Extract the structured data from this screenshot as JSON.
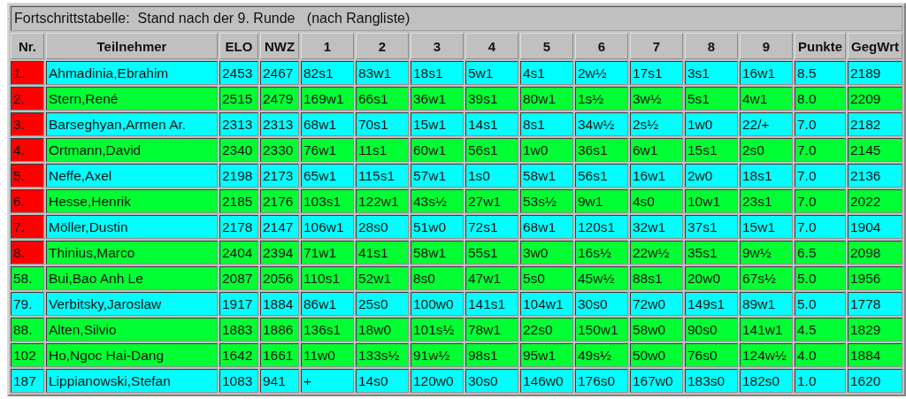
{
  "title": "Fortschrittstabelle:  Stand nach der 9. Runde   (nach Rangliste)",
  "columns": [
    "Nr.",
    "Teilnehmer",
    "ELO",
    "NWZ",
    "1",
    "2",
    "3",
    "4",
    "5",
    "6",
    "7",
    "8",
    "9",
    "Punkte",
    "GegWrt"
  ],
  "rows": [
    {
      "nr": "1.",
      "marked": true,
      "color": "#00ffff",
      "cells": [
        "Ahmadinia,Ebrahim",
        "2453",
        "2467",
        "82s1",
        "83w1",
        "18s1",
        "5w1",
        "4s1",
        "2w½",
        "17s1",
        "3s1",
        "16w1",
        "8.5",
        "2189"
      ]
    },
    {
      "nr": "2.",
      "marked": true,
      "color": "#00ff33",
      "cells": [
        "Stern,René",
        "2515",
        "2479",
        "169w1",
        "66s1",
        "36w1",
        "39s1",
        "80w1",
        "1s½",
        "3w½",
        "5s1",
        "4w1",
        "8.0",
        "2209"
      ]
    },
    {
      "nr": "3.",
      "marked": true,
      "color": "#00ffff",
      "cells": [
        "Barseghyan,Armen Ar.",
        "2313",
        "2313",
        "68w1",
        "70s1",
        "15w1",
        "14s1",
        "8s1",
        "34w½",
        "2s½",
        "1w0",
        "22/+",
        "7.0",
        "2182"
      ]
    },
    {
      "nr": "4.",
      "marked": true,
      "color": "#00ff33",
      "cells": [
        "Ortmann,David",
        "2340",
        "2330",
        "76w1",
        "11s1",
        "60w1",
        "56s1",
        "1w0",
        "36s1",
        "6w1",
        "15s1",
        "2s0",
        "7.0",
        "2145"
      ]
    },
    {
      "nr": "5.",
      "marked": true,
      "color": "#00ffff",
      "cells": [
        "Neffe,Axel",
        "2198",
        "2173",
        "65w1",
        "115s1",
        "57w1",
        "1s0",
        "58w1",
        "56s1",
        "16w1",
        "2w0",
        "18s1",
        "7.0",
        "2136"
      ]
    },
    {
      "nr": "6.",
      "marked": true,
      "color": "#00ff33",
      "cells": [
        "Hesse,Henrik",
        "2185",
        "2176",
        "103s1",
        "122w1",
        "43s½",
        "27w1",
        "53s½",
        "9w1",
        "4s0",
        "10w1",
        "23s1",
        "7.0",
        "2022"
      ]
    },
    {
      "nr": "7.",
      "marked": true,
      "color": "#00ffff",
      "cells": [
        "Möller,Dustin",
        "2178",
        "2147",
        "106w1",
        "28s0",
        "51w0",
        "72s1",
        "68w1",
        "120s1",
        "32w1",
        "37s1",
        "15w1",
        "7.0",
        "1904"
      ]
    },
    {
      "nr": "8.",
      "marked": true,
      "color": "#00ff33",
      "cells": [
        "Thinius,Marco",
        "2404",
        "2394",
        "71w1",
        "41s1",
        "58w1",
        "55s1",
        "3w0",
        "16s½",
        "22w½",
        "35s1",
        "9w½",
        "6.5",
        "2098"
      ]
    },
    {
      "nr": "58.",
      "marked": false,
      "color": "#00ff33",
      "cells": [
        "Bui,Bao Anh Le",
        "2087",
        "2056",
        "110s1",
        "52w1",
        "8s0",
        "47w1",
        "5s0",
        "45w½",
        "88s1",
        "20w0",
        "67s½",
        "5.0",
        "1956"
      ]
    },
    {
      "nr": "79.",
      "marked": false,
      "color": "#00ffff",
      "cells": [
        "Verbitsky,Jaroslaw",
        "1917",
        "1884",
        "86w1",
        "25s0",
        "100w0",
        "141s1",
        "104w1",
        "30s0",
        "72w0",
        "149s1",
        "89w1",
        "5.0",
        "1778"
      ]
    },
    {
      "nr": "88.",
      "marked": false,
      "color": "#00ff33",
      "cells": [
        "Alten,Silvio",
        "1883",
        "1886",
        "136s1",
        "18w0",
        "101s½",
        "78w1",
        "22s0",
        "150w1",
        "58w0",
        "90s0",
        "141w1",
        "4.5",
        "1829"
      ]
    },
    {
      "nr": "102",
      "marked": false,
      "color": "#00ff33",
      "cells": [
        "Ho,Ngoc Hai-Dang",
        "1642",
        "1661",
        "11w0",
        "133s½",
        "91w½",
        "98s1",
        "95w1",
        "49s½",
        "50w0",
        "76s0",
        "124w½",
        "4.0",
        "1884"
      ]
    },
    {
      "nr": "187",
      "marked": false,
      "color": "#00ffff",
      "cells": [
        "Lippianowski,Stefan",
        "1083",
        "941",
        "+",
        "14s0",
        "120w0",
        "30s0",
        "146w0",
        "176s0",
        "167w0",
        "183s0",
        "182s0",
        "1.0",
        "1620"
      ]
    }
  ]
}
